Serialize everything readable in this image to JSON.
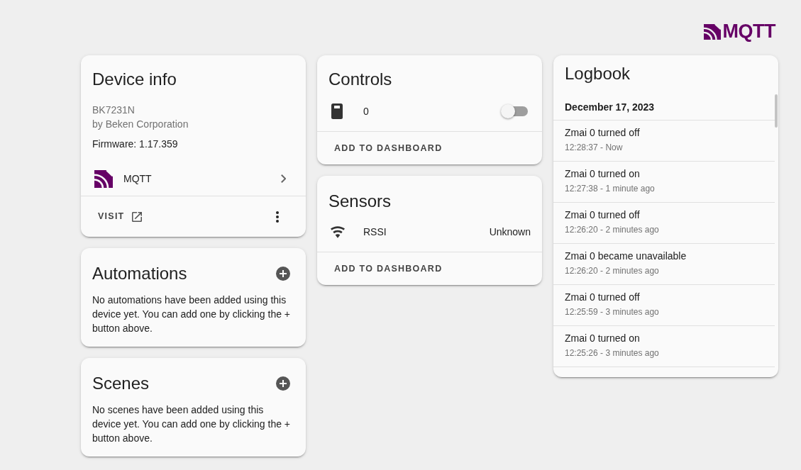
{
  "logo": {
    "text": "MQTT"
  },
  "device_info": {
    "title": "Device info",
    "model": "BK7231N",
    "manufacturer": "by Beken Corporation",
    "firmware": "Firmware: 1.17.359",
    "integration": {
      "name": "MQTT"
    },
    "visit": "VISIT"
  },
  "automations": {
    "title": "Automations",
    "message": "No automations have been added using this device yet. You can add one by clicking the + button above."
  },
  "scenes": {
    "title": "Scenes",
    "message": "No scenes have been added using this device yet. You can add one by clicking the + button above."
  },
  "controls": {
    "title": "Controls",
    "entities": [
      {
        "name": "0",
        "on": false
      }
    ],
    "action": "ADD TO DASHBOARD"
  },
  "sensors": {
    "title": "Sensors",
    "entities": [
      {
        "name": "RSSI",
        "state": "Unknown"
      }
    ],
    "action": "ADD TO DASHBOARD"
  },
  "logbook": {
    "title": "Logbook",
    "date": "December 17, 2023",
    "entries": [
      {
        "message": "Zmai 0 turned off",
        "time": "12:28:37 - Now"
      },
      {
        "message": "Zmai 0 turned on",
        "time": "12:27:38 - 1 minute ago"
      },
      {
        "message": "Zmai 0 turned off",
        "time": "12:26:20 - 2 minutes ago"
      },
      {
        "message": "Zmai 0 became unavailable",
        "time": "12:26:20 - 2 minutes ago"
      },
      {
        "message": "Zmai 0 turned off",
        "time": "12:25:59 - 3 minutes ago"
      },
      {
        "message": "Zmai 0 turned on",
        "time": "12:25:26 - 3 minutes ago"
      }
    ]
  }
}
